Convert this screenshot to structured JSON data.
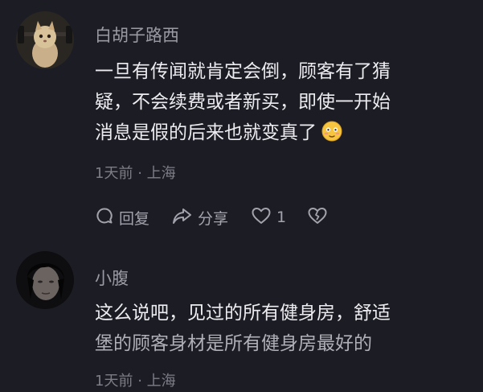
{
  "comments": [
    {
      "username": "白胡子路西",
      "text_lines": [
        "一旦有传闻就肯定会倒，顾客有了猜",
        "疑，不会续费或者新买，即使一开始",
        "消息是假的后来也就变真了"
      ],
      "emoji": "blush-face",
      "time": "1天前",
      "separator": "·",
      "location": "上海",
      "actions": {
        "reply": "回复",
        "share": "分享",
        "like_count": "1"
      }
    },
    {
      "username": "小腹",
      "text_lines": [
        "这么说吧，见过的所有健身房，舒适",
        "堡的顾客身材是所有健身房最好的"
      ],
      "time": "1天前",
      "separator": "·",
      "location": "上海"
    }
  ],
  "colors": {
    "background": "#1c1c24",
    "text": "#ececf0",
    "username": "#9a9aa4",
    "meta": "#7d7d87"
  }
}
